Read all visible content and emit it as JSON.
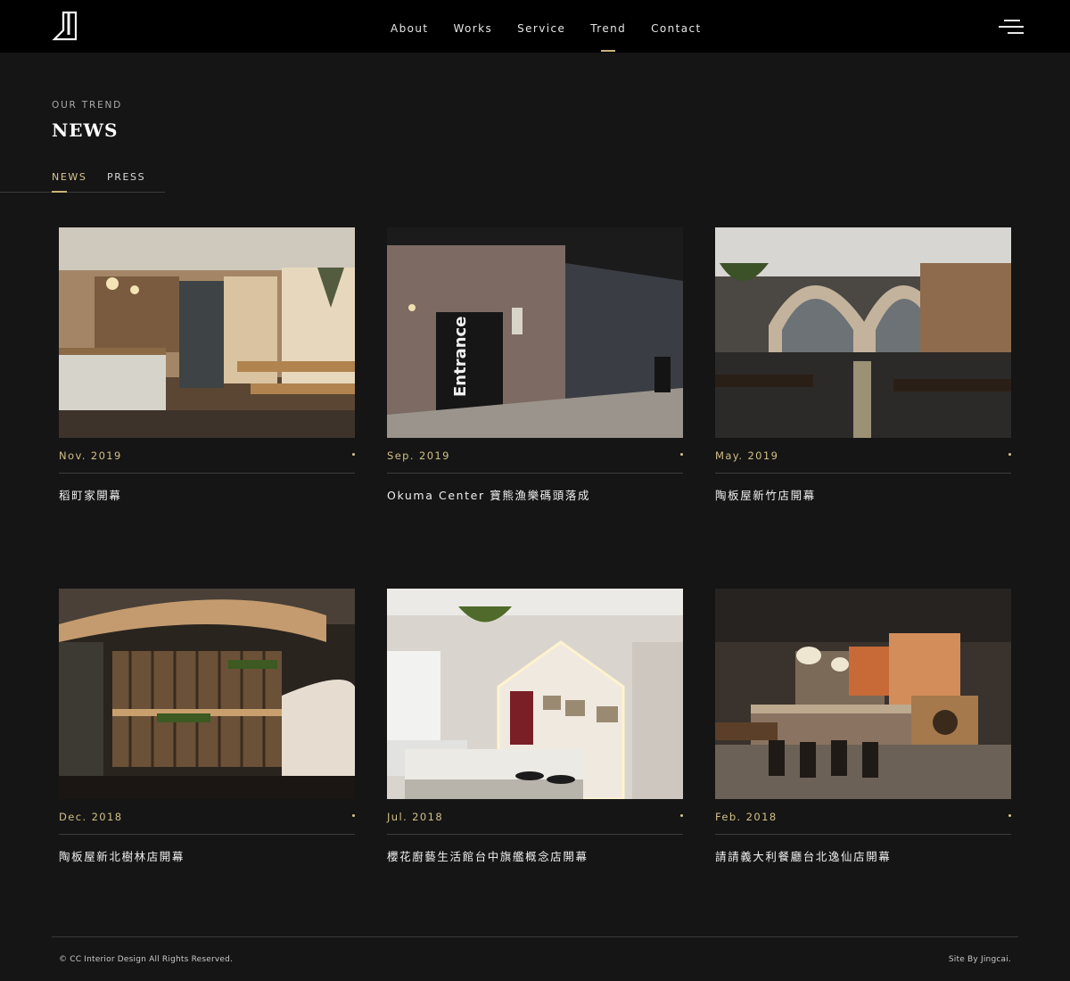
{
  "header": {
    "nav": [
      {
        "label": "About"
      },
      {
        "label": "Works"
      },
      {
        "label": "Service"
      },
      {
        "label": "Trend",
        "active": true
      },
      {
        "label": "Contact"
      }
    ]
  },
  "heading": {
    "eyebrow": "OUR TREND",
    "title": "NEWS"
  },
  "tabs": [
    {
      "label": "NEWS",
      "active": true
    },
    {
      "label": "PRESS"
    }
  ],
  "news": [
    {
      "date": "Nov. 2019",
      "title": "稻町家開幕",
      "image": "cafe-counter-interior"
    },
    {
      "date": "Sep. 2019",
      "title": "Okuma Center 寶熊漁樂碼頭落成",
      "image": "entrance-brick-corridor"
    },
    {
      "date": "May. 2019",
      "title": "陶板屋新竹店開幕",
      "image": "arched-dining-hall"
    },
    {
      "date": "Dec. 2018",
      "title": "陶板屋新北樹林店開幕",
      "image": "curved-shelf-wall"
    },
    {
      "date": "Jul. 2018",
      "title": "櫻花廚藝生活館台中旗艦概念店開幕",
      "image": "kitchen-showroom"
    },
    {
      "date": "Feb. 2018",
      "title": "請請義大利餐廳台北逸仙店開幕",
      "image": "restaurant-bar-interior"
    }
  ],
  "footer": {
    "copyright": "© CC Interior Design All Rights Reserved.",
    "credit": "Site By Jingcai."
  },
  "colors": {
    "background": "#151515",
    "topbar": "#000000",
    "accent": "#c9b57a"
  }
}
